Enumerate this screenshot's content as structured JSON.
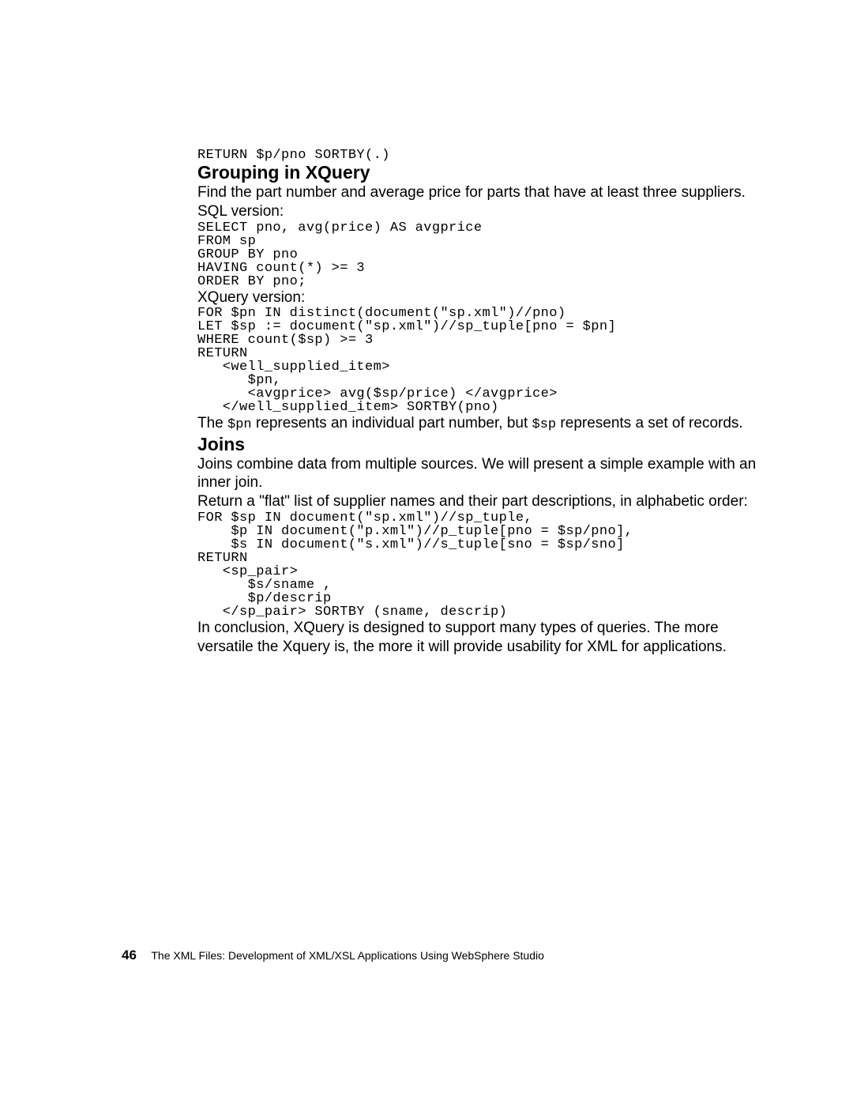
{
  "code1": "RETURN $p/pno SORTBY(.)",
  "section1": {
    "heading": "Grouping in XQuery",
    "intro": "Find the part number and average price for parts that have at least three suppliers.",
    "sql_label": "SQL version:",
    "sql_code": "SELECT pno, avg(price) AS avgprice\nFROM sp\nGROUP BY pno\nHAVING count(*) >= 3\nORDER BY pno;",
    "xquery_label": "XQuery version:",
    "xquery_code": "FOR $pn IN distinct(document(\"sp.xml\")//pno)\nLET $sp := document(\"sp.xml\")//sp_tuple[pno = $pn]\nWHERE count($sp) >= 3\nRETURN\n   <well_supplied_item>\n      $pn,\n      <avgprice> avg($sp/price) </avgprice>\n   </well_supplied_item> SORTBY(pno)",
    "closing_pre": "The ",
    "pn": "$pn",
    "closing_mid": " represents an individual part number, but ",
    "sp": "$sp",
    "closing_post": " represents a set of records."
  },
  "section2": {
    "heading": "Joins",
    "intro": "Joins combine data from multiple sources. We will present a simple example with an inner join.",
    "task": "Return a \"flat\" list of supplier names and their part descriptions, in alphabetic order:",
    "code": "FOR $sp IN document(\"sp.xml\")//sp_tuple,\n    $p IN document(\"p.xml\")//p_tuple[pno = $sp/pno],\n    $s IN document(\"s.xml\")//s_tuple[sno = $sp/sno]\nRETURN\n   <sp_pair>\n      $s/sname ,\n      $p/descrip\n   </sp_pair> SORTBY (sname, descrip)",
    "conclusion": "In conclusion, XQuery is designed to support many types of queries. The more versatile the Xquery is, the more it will provide usability for XML for applications."
  },
  "footer": {
    "pagenum": "46",
    "title": "The XML Files:  Development of XML/XSL Applications Using WebSphere Studio"
  }
}
